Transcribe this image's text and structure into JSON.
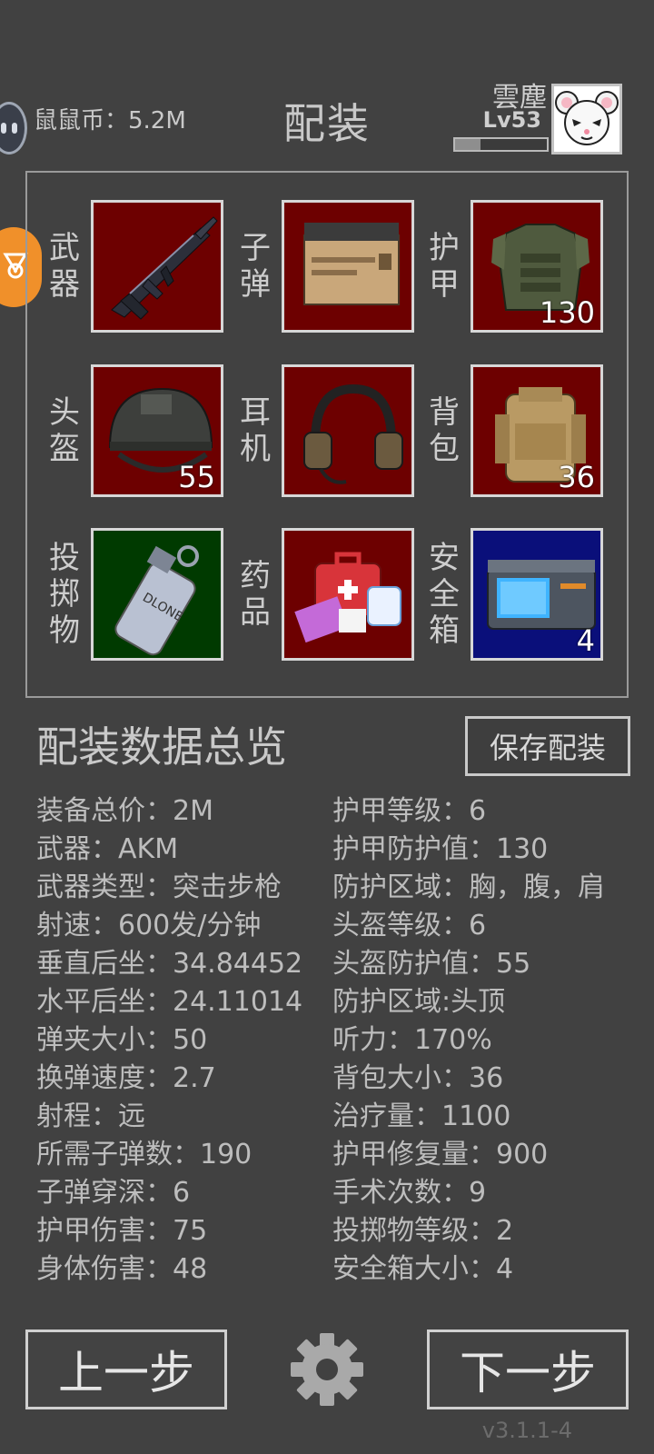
{
  "header": {
    "coins": "鼠鼠币：5.2M",
    "title": "配装",
    "username": "雲塵",
    "level": "Lv53",
    "xp_progress": 0.28
  },
  "slots": [
    {
      "label": [
        "武",
        "器"
      ],
      "icon": "rifle-icon",
      "count": "",
      "bg": "#6d0000"
    },
    {
      "label": [
        "子",
        "弹"
      ],
      "icon": "ammo-box-icon",
      "count": "",
      "bg": "#6d0000"
    },
    {
      "label": [
        "护",
        "甲"
      ],
      "icon": "armor-vest-icon",
      "count": "130",
      "bg": "#6d0000"
    },
    {
      "label": [
        "头",
        "盔"
      ],
      "icon": "helmet-icon",
      "count": "55",
      "bg": "#6d0000"
    },
    {
      "label": [
        "耳",
        "机"
      ],
      "icon": "headset-icon",
      "count": "",
      "bg": "#6d0000"
    },
    {
      "label": [
        "背",
        "包"
      ],
      "icon": "backpack-icon",
      "count": "36",
      "bg": "#6d0000"
    },
    {
      "label": [
        "投",
        "掷",
        "物"
      ],
      "icon": "grenade-icon",
      "count": "",
      "bg": "#003a00"
    },
    {
      "label": [
        "药",
        "品"
      ],
      "icon": "medkit-icon",
      "count": "",
      "bg": "#6d0000"
    },
    {
      "label": [
        "安",
        "全",
        "箱"
      ],
      "icon": "secure-case-icon",
      "count": "4",
      "bg": "#0a0f7a"
    }
  ],
  "summary": {
    "title": "配装数据总览",
    "save_label": "保存配装",
    "left": [
      "装备总价：2M",
      "武器：AKM",
      "武器类型：突击步枪",
      "射速：600发/分钟",
      "垂直后坐：34.84452",
      "水平后坐：24.11014",
      "弹夹大小：50",
      "换弹速度：2.7",
      "射程：远",
      "所需子弹数：190",
      "子弹穿深：6",
      "护甲伤害：75",
      "身体伤害：48"
    ],
    "right": [
      "护甲等级：6",
      "护甲防护值：130",
      "防护区域：胸，腹，肩",
      "头盔等级：6",
      "头盔防护值：55",
      "防护区域:头顶",
      "听力：170%",
      "背包大小：36",
      "治疗量：1100",
      "护甲修复量：900",
      "手术次数：9",
      "投掷物等级：2",
      "安全箱大小：4"
    ]
  },
  "footer": {
    "prev_label": "上一步",
    "next_label": "下一步",
    "version": "v3.1.1-4"
  }
}
